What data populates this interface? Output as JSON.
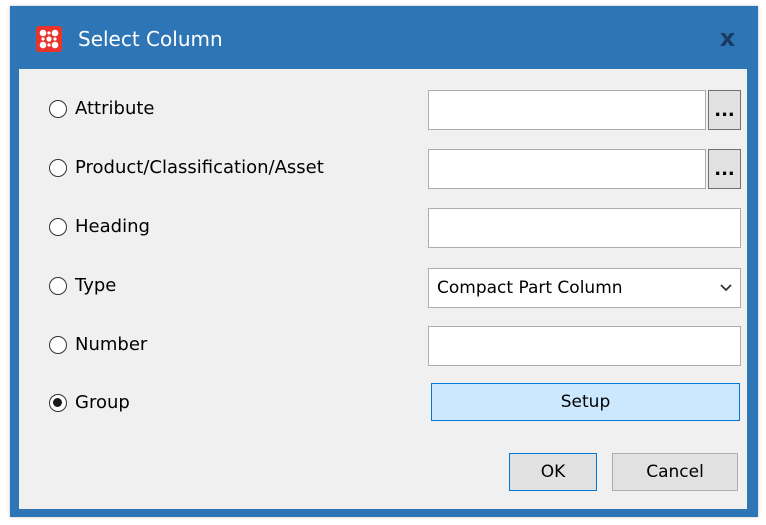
{
  "window": {
    "title": "Select Column",
    "close_glyph": "x",
    "app_icon": "app-logo-icon"
  },
  "options": [
    {
      "label": "Attribute",
      "checked": false
    },
    {
      "label": "Product/Classification/Asset",
      "checked": false
    },
    {
      "label": "Heading",
      "checked": false
    },
    {
      "label": "Type",
      "checked": false
    },
    {
      "label": "Number",
      "checked": false
    },
    {
      "label": "Group",
      "checked": true
    }
  ],
  "fields": {
    "attribute_value": "",
    "product_value": "",
    "heading_value": "",
    "number_value": "",
    "browse_label": "..."
  },
  "type_select": {
    "selected": "Compact Part Column"
  },
  "buttons": {
    "setup": "Setup",
    "ok": "OK",
    "cancel": "Cancel"
  },
  "colors": {
    "titlebar": "#2e75b6",
    "accent": "#0078d7",
    "setup_bg": "#cce8ff",
    "icon_red": "#e8342b"
  }
}
